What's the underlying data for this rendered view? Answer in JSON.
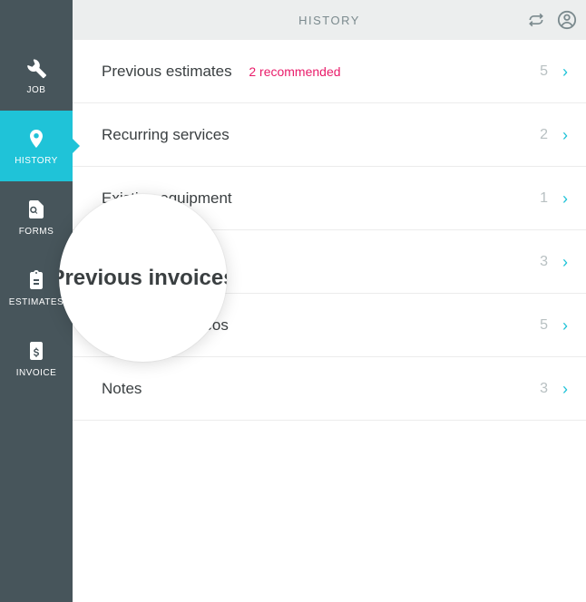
{
  "header": {
    "title": "HISTORY"
  },
  "sidebar": {
    "items": [
      {
        "label": "JOB"
      },
      {
        "label": "HISTORY"
      },
      {
        "label": "FORMS"
      },
      {
        "label": "ESTIMATES"
      },
      {
        "label": "INVOICE"
      }
    ]
  },
  "rows": [
    {
      "label": "Previous estimates",
      "sub": "2 recommended",
      "count": "5"
    },
    {
      "label": "Recurring services",
      "sub": "",
      "count": "2"
    },
    {
      "label": "Existing equipment",
      "sub": "",
      "count": "1"
    },
    {
      "label": "Previous invoices",
      "sub": "",
      "count": "3"
    },
    {
      "label": "Photos and videos",
      "sub": "",
      "count": "5"
    },
    {
      "label": "Notes",
      "sub": "",
      "count": "3"
    }
  ],
  "magnifier": {
    "text": "Previous invoices"
  }
}
